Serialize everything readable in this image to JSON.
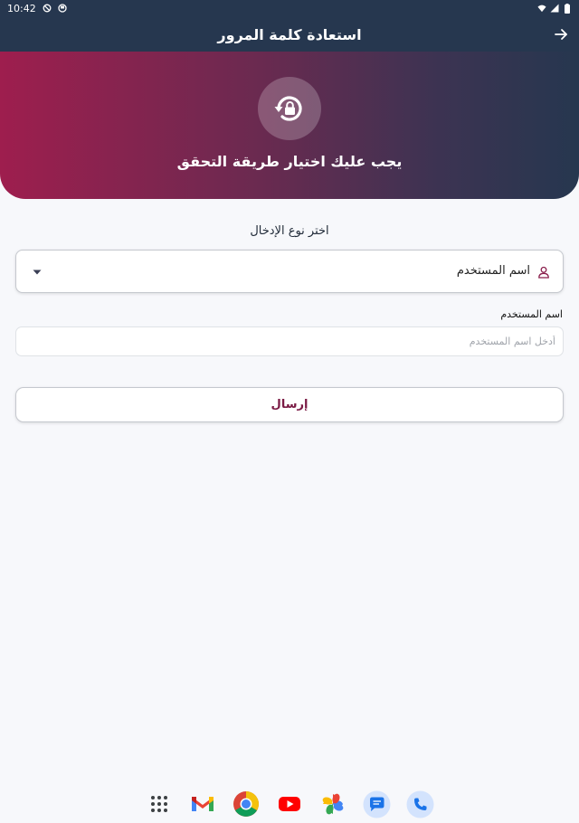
{
  "status_bar": {
    "time": "10:42"
  },
  "app_bar": {
    "title": "استعادة كلمة المرور",
    "back_icon": "arrow-right-icon"
  },
  "hero": {
    "icon": "lock-reset-icon",
    "message": "يجب عليك اختيار طريقة التحقق"
  },
  "form": {
    "input_type_label": "اختر نوع الإدخال",
    "input_type_selected": "اسم المستخدم",
    "username_label": "اسم المستخدم",
    "username_placeholder": "أدخل اسم المستخدم",
    "username_value": "",
    "submit_label": "إرسال"
  },
  "colors": {
    "app_bar": "#26374f",
    "hero_start": "#9e1e4e",
    "hero_end": "#26374f",
    "accent": "#7a1a44"
  },
  "dock": {
    "apps": [
      "app-drawer-icon",
      "gmail-icon",
      "chrome-icon",
      "youtube-icon",
      "photos-icon",
      "messages-icon",
      "phone-icon"
    ]
  }
}
